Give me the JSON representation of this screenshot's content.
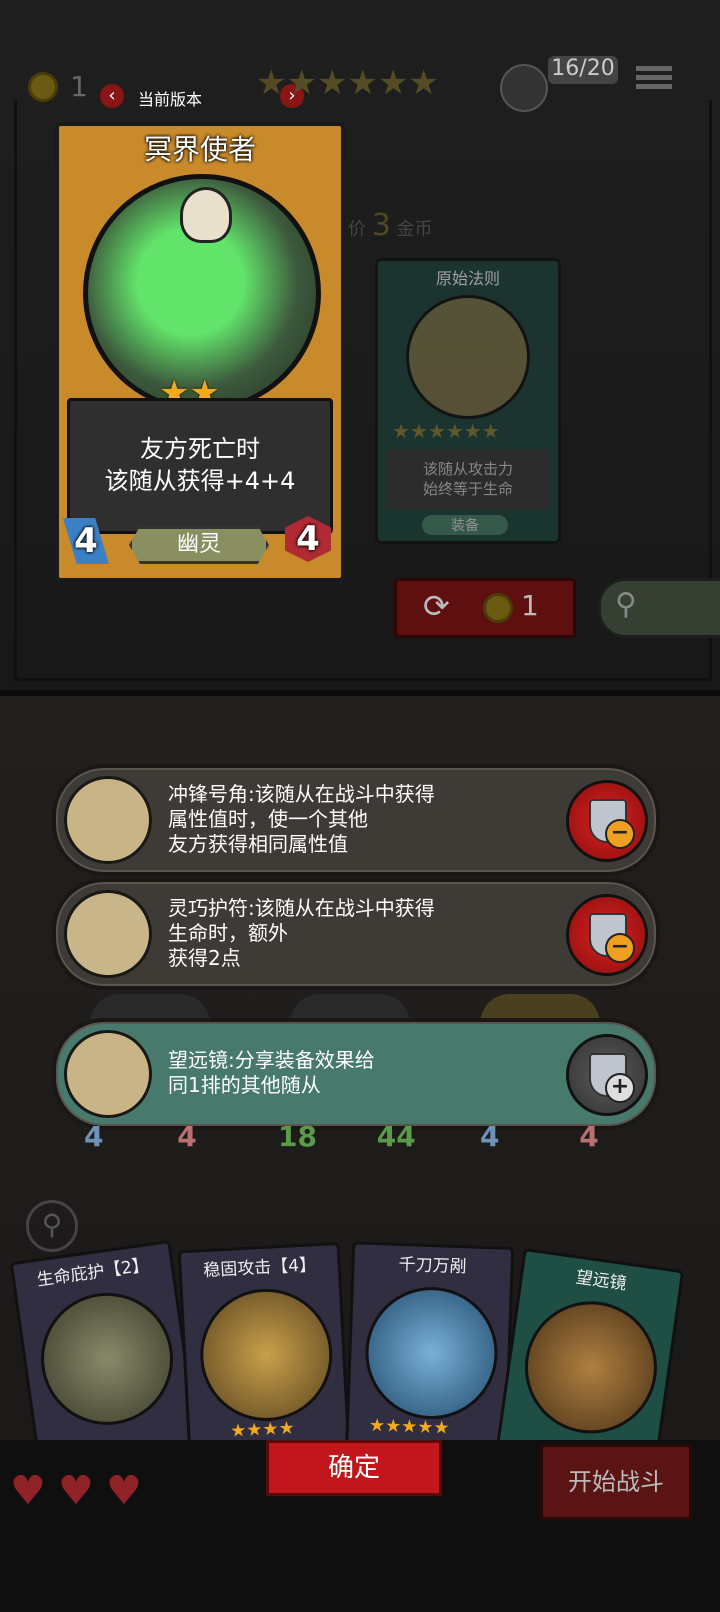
{
  "header": {
    "gold": "1",
    "version_label": "当前版本",
    "counter": "16/20",
    "price_prefix": "价",
    "price_value": "3",
    "price_unit": "金币",
    "tier_stars": 6
  },
  "main_card": {
    "name": "冥界使者",
    "stars": 2,
    "desc_line1": "友方死亡时",
    "desc_line2": "该随从获得+4+4",
    "attack": "4",
    "health": "4",
    "tribe": "幽灵"
  },
  "secondary_card": {
    "name": "原始法则",
    "stars": 6,
    "desc_line1": "该随从攻击力",
    "desc_line2": "始终等于生命",
    "tag": "装备"
  },
  "refresh": {
    "cost": "1"
  },
  "equipment": [
    {
      "line1": "冲锋号角:该随从在战斗中获得",
      "line2": "属性值时，使一个其他",
      "line3": "友方获得相同属性值",
      "action": "remove"
    },
    {
      "line1": "灵巧护符:该随从在战斗中获得",
      "line2": "生命时，额外",
      "line3": "获得2点",
      "action": "remove"
    },
    {
      "line1": "望远镜:分享装备效果给",
      "line2": "同1排的其他随从",
      "line3": "",
      "action": "add"
    }
  ],
  "board_stats": [
    {
      "attack": "4",
      "health": "4"
    },
    {
      "attack": "18",
      "health": "44"
    },
    {
      "attack": "4",
      "health": "4"
    }
  ],
  "hand": [
    {
      "name": "生命庇护【2】"
    },
    {
      "name": "稳固攻击【4】"
    },
    {
      "name": "千刀万剐"
    },
    {
      "name": "望远镜"
    }
  ],
  "buttons": {
    "confirm": "确定",
    "start": "开始战斗"
  },
  "colors": {
    "gold": "#f2a91c",
    "red_button": "#c0161c",
    "teal_card": "#477a6c"
  }
}
